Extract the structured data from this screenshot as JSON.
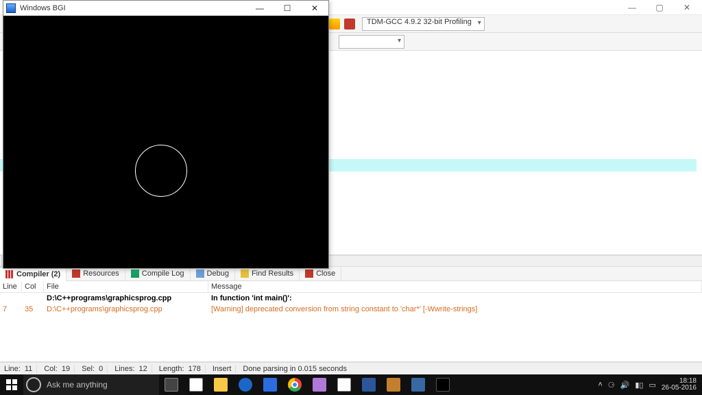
{
  "ide": {
    "toolbar": {
      "compiler": "TDM-GCC 4.9.2 32-bit Profiling"
    },
    "bottom_tabs": {
      "compiler": "Compiler (2)",
      "resources": "Resources",
      "compile_log": "Compile Log",
      "debug": "Debug",
      "find_results": "Find Results",
      "close": "Close"
    },
    "ct_headers": {
      "line": "Line",
      "col": "Col",
      "file": "File",
      "msg": "Message"
    },
    "ct_rows": [
      {
        "line": "",
        "col": "",
        "file": "D:\\C++programs\\graphicsprog.cpp",
        "msg": "In function 'int main()':",
        "bold": true
      },
      {
        "line": "7",
        "col": "35",
        "file": "D:\\C++programs\\graphicsprog.cpp",
        "msg": "[Warning] deprecated conversion from string constant to 'char*' [-Wwrite-strings]",
        "warn": true
      }
    ],
    "status": {
      "line_k": "Line:",
      "line_v": "11",
      "col_k": "Col:",
      "col_v": "19",
      "sel_k": "Sel:",
      "sel_v": "0",
      "lines_k": "Lines:",
      "lines_v": "12",
      "length_k": "Length:",
      "length_v": "178",
      "mode": "Insert",
      "parse": "Done parsing in 0.015 seconds"
    }
  },
  "bgi": {
    "title": "Windows BGI"
  },
  "taskbar": {
    "search_placeholder": "Ask me anything",
    "clock_time": "18:18",
    "clock_date": "26-05-2016"
  }
}
